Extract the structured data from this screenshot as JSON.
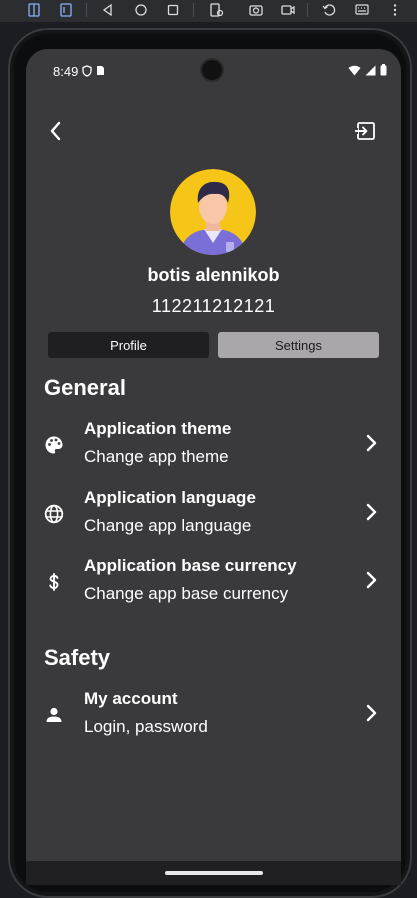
{
  "status_bar": {
    "time": "8:49"
  },
  "profile": {
    "name": "botis alennikob",
    "phone": "112211212121"
  },
  "tabs": [
    {
      "label": "Profile",
      "selected": false
    },
    {
      "label": "Settings",
      "selected": true
    }
  ],
  "sections": {
    "general": {
      "title": "General",
      "items": [
        {
          "title": "Application theme",
          "subtitle": "Change app theme",
          "icon": "palette-icon"
        },
        {
          "title": "Application language",
          "subtitle": "Change app language",
          "icon": "globe-icon"
        },
        {
          "title": "Application base currency",
          "subtitle": "Change app base currency",
          "icon": "dollar-icon"
        }
      ]
    },
    "safety": {
      "title": "Safety",
      "items": [
        {
          "title": "My account",
          "subtitle": "Login, password",
          "icon": "person-icon"
        }
      ]
    }
  },
  "colors": {
    "background": "#3a3a3c",
    "tab_profile": "#1f1f21",
    "tab_settings": "#a9a7aa",
    "avatar_bg": "#f5c518"
  }
}
